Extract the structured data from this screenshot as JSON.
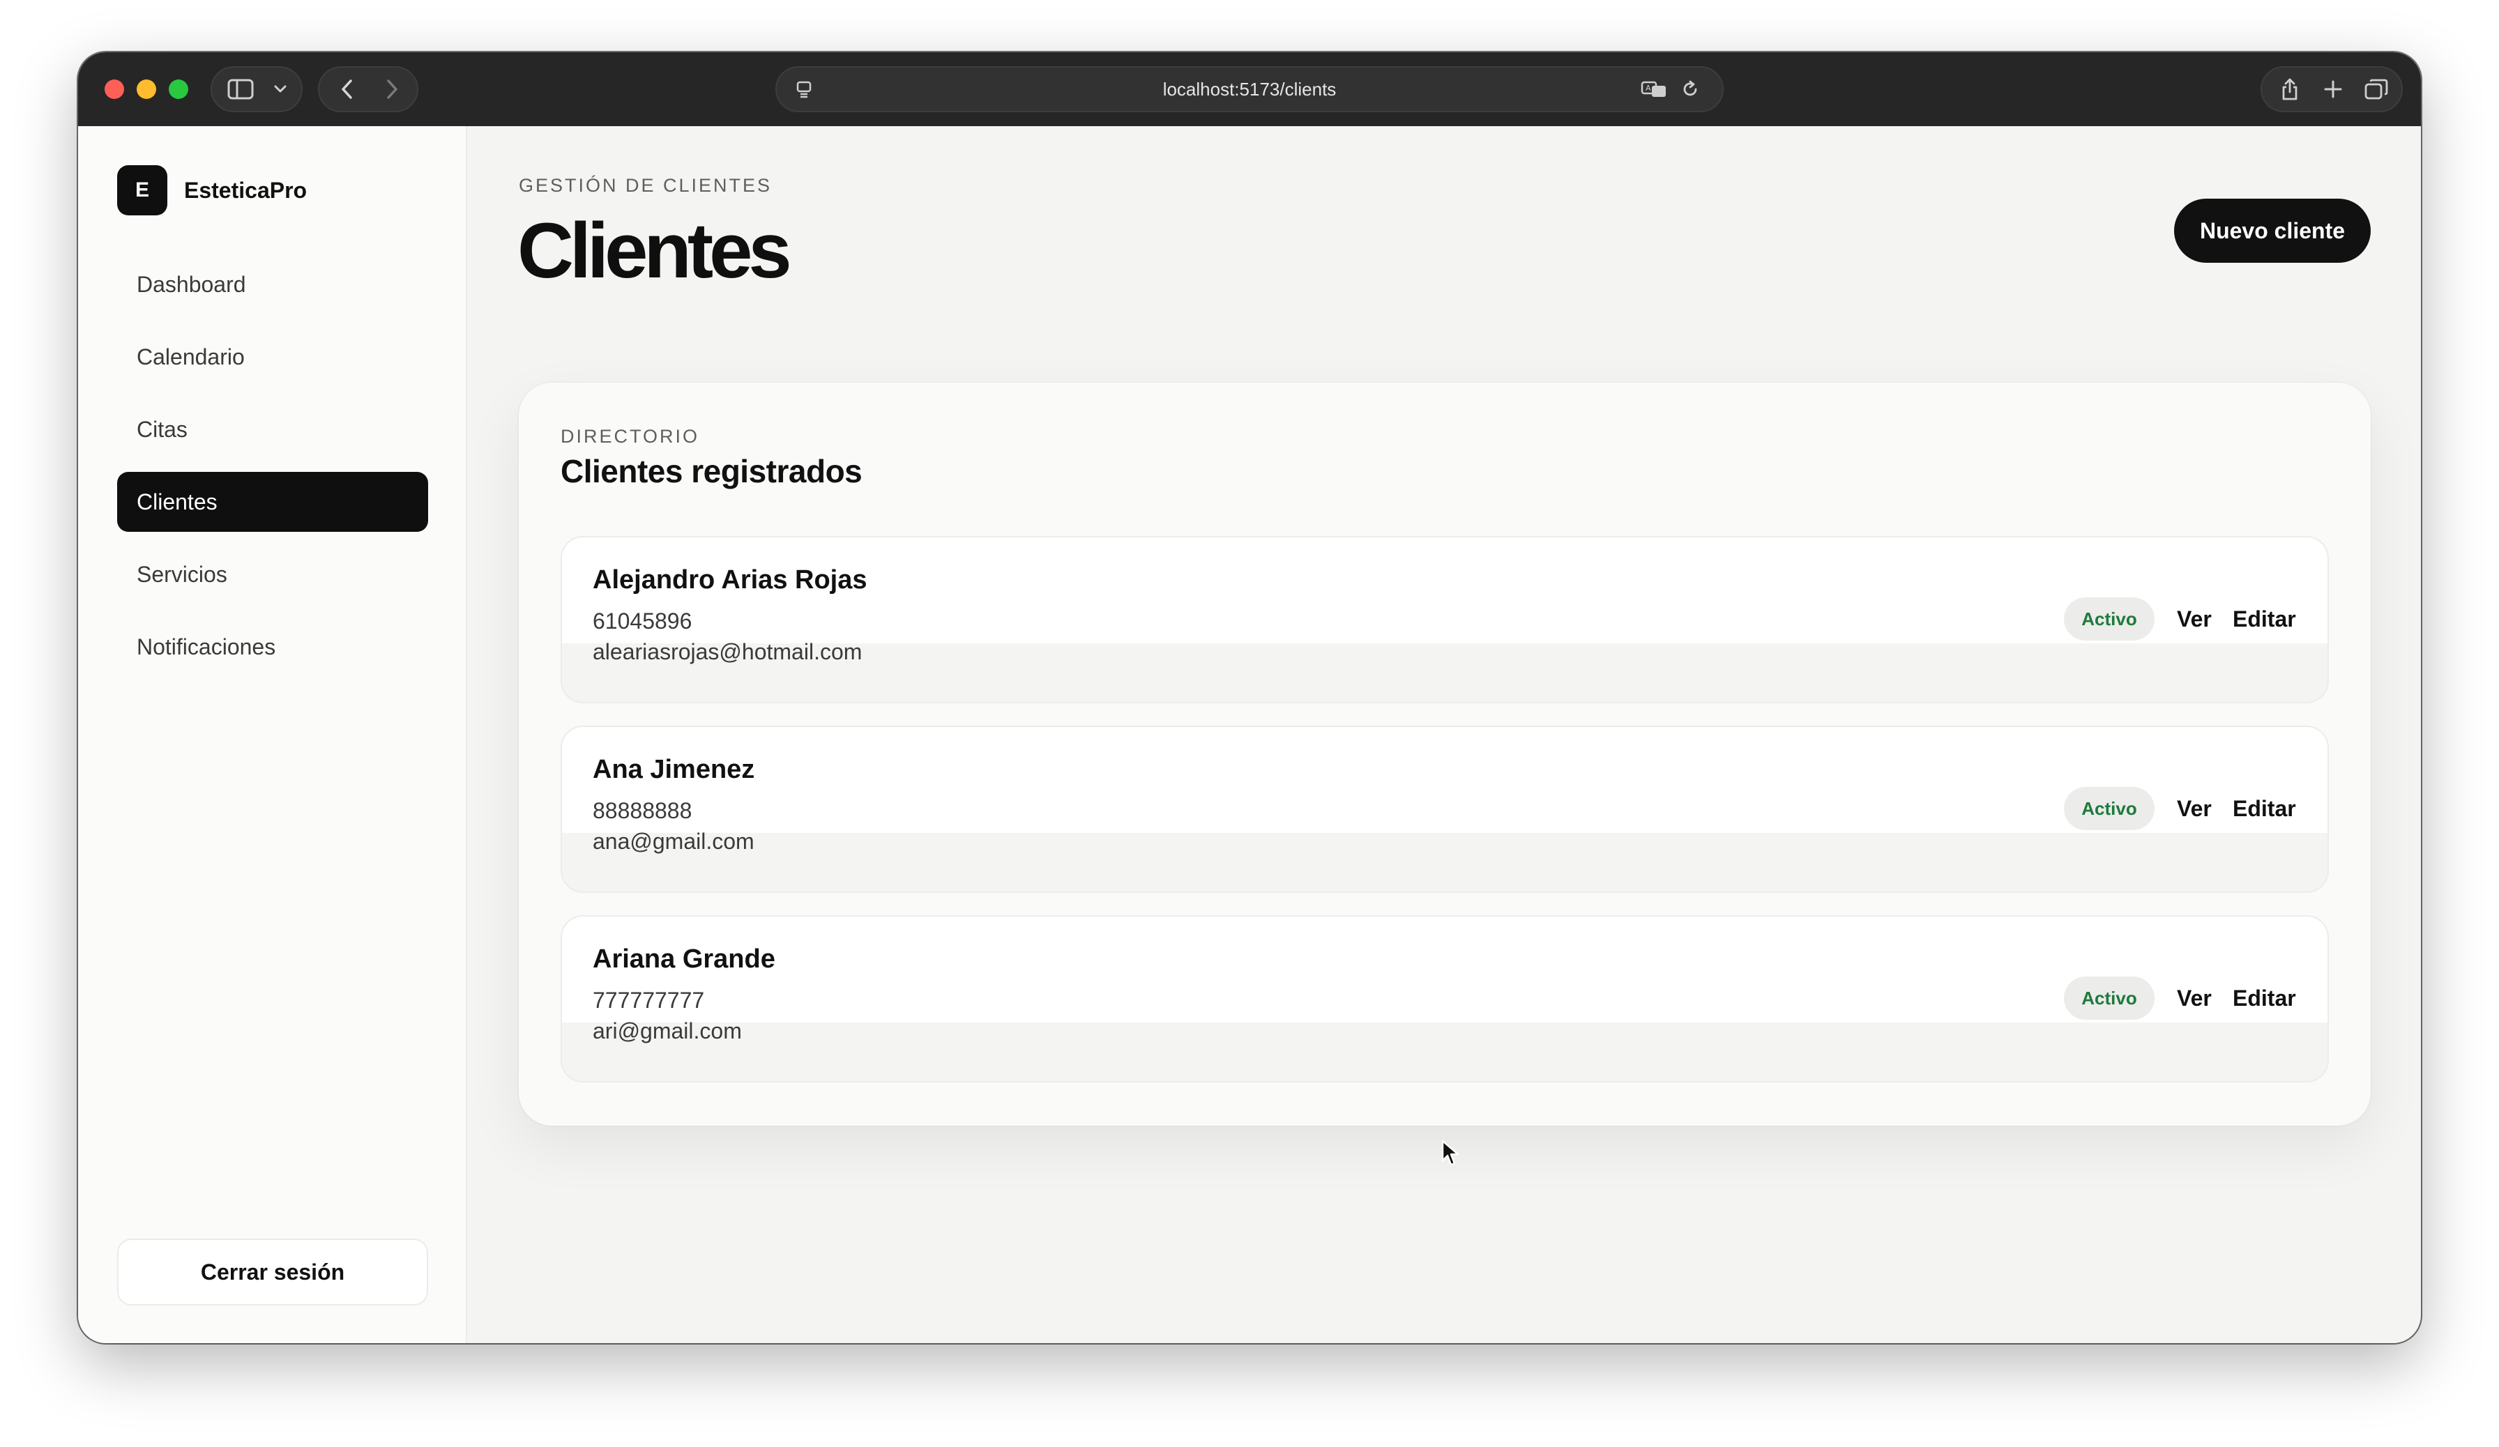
{
  "browser": {
    "url": "localhost:5173/clients"
  },
  "sidebar": {
    "brand_initial": "E",
    "brand_name": "EsteticaPro",
    "items": [
      {
        "label": "Dashboard"
      },
      {
        "label": "Calendario"
      },
      {
        "label": "Citas"
      },
      {
        "label": "Clientes"
      },
      {
        "label": "Servicios"
      },
      {
        "label": "Notificaciones"
      }
    ],
    "active_item": "Clientes",
    "logout_label": "Cerrar sesión"
  },
  "header": {
    "eyebrow": "GESTIÓN DE CLIENTES",
    "title": "Clientes",
    "new_button_label": "Nuevo cliente"
  },
  "directory": {
    "eyebrow": "DIRECTORIO",
    "title": "Clientes registrados",
    "clients": [
      {
        "name": "Alejandro Arias Rojas",
        "phone": "61045896",
        "email": "aleariasrojas@hotmail.com",
        "status": "Activo",
        "view_label": "Ver",
        "edit_label": "Editar"
      },
      {
        "name": "Ana Jimenez",
        "phone": "88888888",
        "email": "ana@gmail.com",
        "status": "Activo",
        "view_label": "Ver",
        "edit_label": "Editar"
      },
      {
        "name": "Ariana Grande",
        "phone": "777777777",
        "email": "ari@gmail.com",
        "status": "Activo",
        "view_label": "Ver",
        "edit_label": "Editar"
      }
    ]
  },
  "colors": {
    "accent": "#111111",
    "status_active": "#1f7a3d",
    "background": "#f4f4f2"
  },
  "icons": [
    "sidebar-toggle-icon",
    "chevron-down-icon",
    "back-icon",
    "forward-icon",
    "page-settings-icon",
    "translate-icon",
    "reload-icon",
    "share-icon",
    "new-tab-icon",
    "tabs-overview-icon",
    "mouse-cursor-icon"
  ]
}
